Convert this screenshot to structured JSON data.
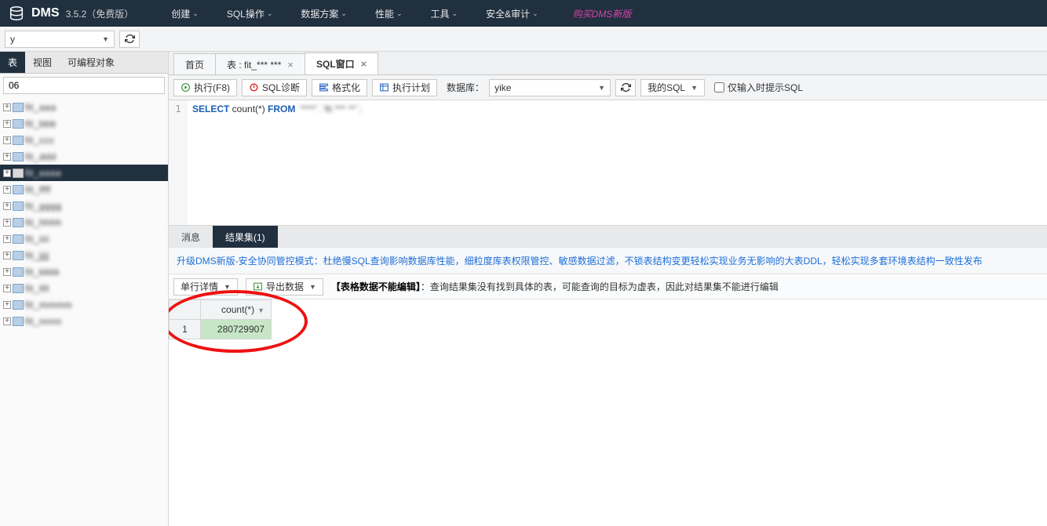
{
  "header": {
    "app_name": "DMS",
    "version": "3.5.2",
    "edition": "（免费版）",
    "nav": [
      "创建",
      "SQL操作",
      "数据方案",
      "性能",
      "工具",
      "安全&审计"
    ],
    "buy": "购买DMS新版"
  },
  "connection_bar": {
    "value": "y"
  },
  "sidebar": {
    "tabs": [
      "表",
      "视图",
      "可编程对象"
    ],
    "filter_value": "06",
    "tree_items": [
      {
        "label": "fit_aaa",
        "selected": false
      },
      {
        "label": "fit_bbb",
        "selected": false
      },
      {
        "label": "fit_ccc",
        "selected": false
      },
      {
        "label": "fit_ddd",
        "selected": false
      },
      {
        "label": "fit_eeee",
        "selected": true
      },
      {
        "label": "fit_ffff",
        "selected": false
      },
      {
        "label": "fit_gggg",
        "selected": false
      },
      {
        "label": "fit_hhhh",
        "selected": false
      },
      {
        "label": "fit_iiii",
        "selected": false
      },
      {
        "label": "fit_jjjj",
        "selected": false
      },
      {
        "label": "fit_kkkk",
        "selected": false
      },
      {
        "label": "fit_llll",
        "selected": false
      },
      {
        "label": "fit_mmmm",
        "selected": false
      },
      {
        "label": "fit_nnnn",
        "selected": false
      }
    ]
  },
  "tabs": {
    "items": [
      {
        "label": "首页",
        "closable": false,
        "active": false
      },
      {
        "label": "表 : fit_***  ***",
        "closable": true,
        "active": false
      },
      {
        "label": "SQL窗口",
        "closable": true,
        "active": true
      }
    ]
  },
  "toolbar": {
    "run": "执行(F8)",
    "diag": "SQL诊断",
    "format": "格式化",
    "plan": "执行计划",
    "db_label": "数据库：",
    "db_value": "yike",
    "my_sql": "我的SQL",
    "hint_checkbox": "仅输入时提示SQL"
  },
  "editor": {
    "line_num": "1",
    "kw_select": "SELECT",
    "expr": " count(*) ",
    "kw_from": "FROM",
    "rest": " `****`.`fit *** **`;"
  },
  "result_tabs": {
    "msg": "消息",
    "result": "结果集(1)"
  },
  "promo": "升级DMS新版-安全协同管控模式：杜绝慢SQL查询影响数据库性能，细粒度库表权限管控、敏感数据过滤，不锁表结构变更轻松实现业务无影响的大表DDL，轻松实现多套环境表结构一致性发布",
  "result_bar": {
    "detail": "单行详情",
    "export": "导出数据",
    "note_bold": "【表格数据不能编辑】",
    "note_rest": "：查询结果集没有找到具体的表，可能查询的目标为虚表，因此对结果集不能进行编辑"
  },
  "grid": {
    "col": "count(*)",
    "row_num": "1",
    "value": "280729907"
  }
}
